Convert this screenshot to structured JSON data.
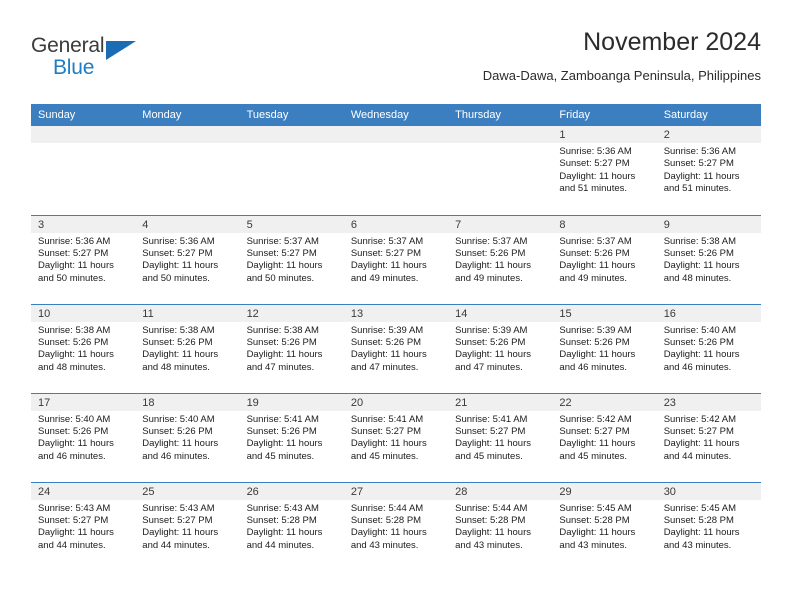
{
  "brand": {
    "name_top": "General",
    "name_bottom": "Blue",
    "accent_color": "#1b6cb5"
  },
  "header": {
    "title": "November 2024",
    "subtitle": "Dawa-Dawa, Zamboanga Peninsula, Philippines"
  },
  "theme": {
    "header_row_bg": "#3c7fc1",
    "daynum_strip_bg": "#f0f0f0",
    "row_divider": "#3c7fc1"
  },
  "weekday_headers": [
    "Sunday",
    "Monday",
    "Tuesday",
    "Wednesday",
    "Thursday",
    "Friday",
    "Saturday"
  ],
  "labels": {
    "sunrise_prefix": "Sunrise:",
    "sunset_prefix": "Sunset:",
    "daylight_prefix": "Daylight:"
  },
  "weeks": [
    [
      {
        "day": "",
        "empty": true,
        "line1": "",
        "line2": "",
        "line3": "",
        "line4": ""
      },
      {
        "day": "",
        "empty": true,
        "line1": "",
        "line2": "",
        "line3": "",
        "line4": ""
      },
      {
        "day": "",
        "empty": true,
        "line1": "",
        "line2": "",
        "line3": "",
        "line4": ""
      },
      {
        "day": "",
        "empty": true,
        "line1": "",
        "line2": "",
        "line3": "",
        "line4": ""
      },
      {
        "day": "",
        "empty": true,
        "line1": "",
        "line2": "",
        "line3": "",
        "line4": ""
      },
      {
        "day": "1",
        "empty": false,
        "line1": "Sunrise: 5:36 AM",
        "line2": "Sunset: 5:27 PM",
        "line3": "Daylight: 11 hours",
        "line4": "and 51 minutes."
      },
      {
        "day": "2",
        "empty": false,
        "line1": "Sunrise: 5:36 AM",
        "line2": "Sunset: 5:27 PM",
        "line3": "Daylight: 11 hours",
        "line4": "and 51 minutes."
      }
    ],
    [
      {
        "day": "3",
        "empty": false,
        "line1": "Sunrise: 5:36 AM",
        "line2": "Sunset: 5:27 PM",
        "line3": "Daylight: 11 hours",
        "line4": "and 50 minutes."
      },
      {
        "day": "4",
        "empty": false,
        "line1": "Sunrise: 5:36 AM",
        "line2": "Sunset: 5:27 PM",
        "line3": "Daylight: 11 hours",
        "line4": "and 50 minutes."
      },
      {
        "day": "5",
        "empty": false,
        "line1": "Sunrise: 5:37 AM",
        "line2": "Sunset: 5:27 PM",
        "line3": "Daylight: 11 hours",
        "line4": "and 50 minutes."
      },
      {
        "day": "6",
        "empty": false,
        "line1": "Sunrise: 5:37 AM",
        "line2": "Sunset: 5:27 PM",
        "line3": "Daylight: 11 hours",
        "line4": "and 49 minutes."
      },
      {
        "day": "7",
        "empty": false,
        "line1": "Sunrise: 5:37 AM",
        "line2": "Sunset: 5:26 PM",
        "line3": "Daylight: 11 hours",
        "line4": "and 49 minutes."
      },
      {
        "day": "8",
        "empty": false,
        "line1": "Sunrise: 5:37 AM",
        "line2": "Sunset: 5:26 PM",
        "line3": "Daylight: 11 hours",
        "line4": "and 49 minutes."
      },
      {
        "day": "9",
        "empty": false,
        "line1": "Sunrise: 5:38 AM",
        "line2": "Sunset: 5:26 PM",
        "line3": "Daylight: 11 hours",
        "line4": "and 48 minutes."
      }
    ],
    [
      {
        "day": "10",
        "empty": false,
        "line1": "Sunrise: 5:38 AM",
        "line2": "Sunset: 5:26 PM",
        "line3": "Daylight: 11 hours",
        "line4": "and 48 minutes."
      },
      {
        "day": "11",
        "empty": false,
        "line1": "Sunrise: 5:38 AM",
        "line2": "Sunset: 5:26 PM",
        "line3": "Daylight: 11 hours",
        "line4": "and 48 minutes."
      },
      {
        "day": "12",
        "empty": false,
        "line1": "Sunrise: 5:38 AM",
        "line2": "Sunset: 5:26 PM",
        "line3": "Daylight: 11 hours",
        "line4": "and 47 minutes."
      },
      {
        "day": "13",
        "empty": false,
        "line1": "Sunrise: 5:39 AM",
        "line2": "Sunset: 5:26 PM",
        "line3": "Daylight: 11 hours",
        "line4": "and 47 minutes."
      },
      {
        "day": "14",
        "empty": false,
        "line1": "Sunrise: 5:39 AM",
        "line2": "Sunset: 5:26 PM",
        "line3": "Daylight: 11 hours",
        "line4": "and 47 minutes."
      },
      {
        "day": "15",
        "empty": false,
        "line1": "Sunrise: 5:39 AM",
        "line2": "Sunset: 5:26 PM",
        "line3": "Daylight: 11 hours",
        "line4": "and 46 minutes."
      },
      {
        "day": "16",
        "empty": false,
        "line1": "Sunrise: 5:40 AM",
        "line2": "Sunset: 5:26 PM",
        "line3": "Daylight: 11 hours",
        "line4": "and 46 minutes."
      }
    ],
    [
      {
        "day": "17",
        "empty": false,
        "line1": "Sunrise: 5:40 AM",
        "line2": "Sunset: 5:26 PM",
        "line3": "Daylight: 11 hours",
        "line4": "and 46 minutes."
      },
      {
        "day": "18",
        "empty": false,
        "line1": "Sunrise: 5:40 AM",
        "line2": "Sunset: 5:26 PM",
        "line3": "Daylight: 11 hours",
        "line4": "and 46 minutes."
      },
      {
        "day": "19",
        "empty": false,
        "line1": "Sunrise: 5:41 AM",
        "line2": "Sunset: 5:26 PM",
        "line3": "Daylight: 11 hours",
        "line4": "and 45 minutes."
      },
      {
        "day": "20",
        "empty": false,
        "line1": "Sunrise: 5:41 AM",
        "line2": "Sunset: 5:27 PM",
        "line3": "Daylight: 11 hours",
        "line4": "and 45 minutes."
      },
      {
        "day": "21",
        "empty": false,
        "line1": "Sunrise: 5:41 AM",
        "line2": "Sunset: 5:27 PM",
        "line3": "Daylight: 11 hours",
        "line4": "and 45 minutes."
      },
      {
        "day": "22",
        "empty": false,
        "line1": "Sunrise: 5:42 AM",
        "line2": "Sunset: 5:27 PM",
        "line3": "Daylight: 11 hours",
        "line4": "and 45 minutes."
      },
      {
        "day": "23",
        "empty": false,
        "line1": "Sunrise: 5:42 AM",
        "line2": "Sunset: 5:27 PM",
        "line3": "Daylight: 11 hours",
        "line4": "and 44 minutes."
      }
    ],
    [
      {
        "day": "24",
        "empty": false,
        "line1": "Sunrise: 5:43 AM",
        "line2": "Sunset: 5:27 PM",
        "line3": "Daylight: 11 hours",
        "line4": "and 44 minutes."
      },
      {
        "day": "25",
        "empty": false,
        "line1": "Sunrise: 5:43 AM",
        "line2": "Sunset: 5:27 PM",
        "line3": "Daylight: 11 hours",
        "line4": "and 44 minutes."
      },
      {
        "day": "26",
        "empty": false,
        "line1": "Sunrise: 5:43 AM",
        "line2": "Sunset: 5:28 PM",
        "line3": "Daylight: 11 hours",
        "line4": "and 44 minutes."
      },
      {
        "day": "27",
        "empty": false,
        "line1": "Sunrise: 5:44 AM",
        "line2": "Sunset: 5:28 PM",
        "line3": "Daylight: 11 hours",
        "line4": "and 43 minutes."
      },
      {
        "day": "28",
        "empty": false,
        "line1": "Sunrise: 5:44 AM",
        "line2": "Sunset: 5:28 PM",
        "line3": "Daylight: 11 hours",
        "line4": "and 43 minutes."
      },
      {
        "day": "29",
        "empty": false,
        "line1": "Sunrise: 5:45 AM",
        "line2": "Sunset: 5:28 PM",
        "line3": "Daylight: 11 hours",
        "line4": "and 43 minutes."
      },
      {
        "day": "30",
        "empty": false,
        "line1": "Sunrise: 5:45 AM",
        "line2": "Sunset: 5:28 PM",
        "line3": "Daylight: 11 hours",
        "line4": "and 43 minutes."
      }
    ]
  ]
}
